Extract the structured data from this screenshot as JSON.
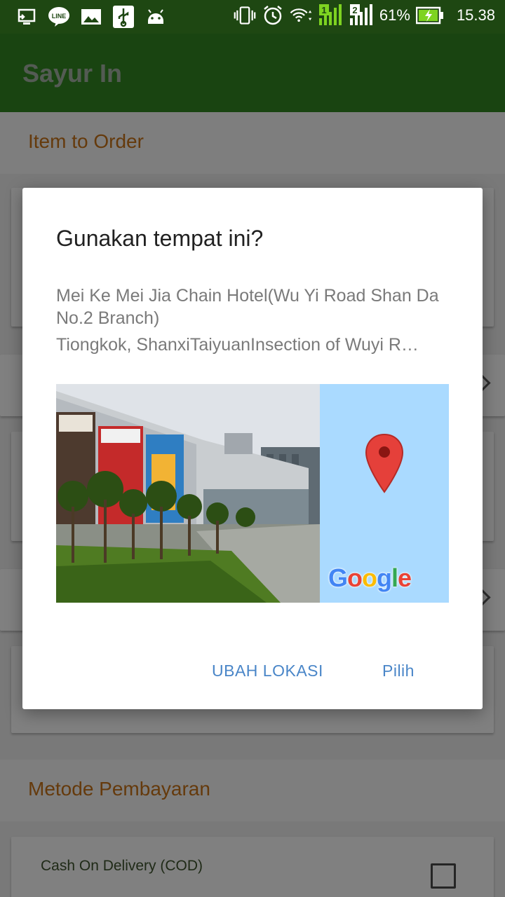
{
  "status_bar": {
    "battery_percent": "61%",
    "time": "15.38",
    "sim1": "1",
    "sim2": "2",
    "line_label": "LINE",
    "icons_left": [
      "screen-cast-icon",
      "line-app-icon",
      "image-icon",
      "usb-icon",
      "android-icon"
    ],
    "icons_right": [
      "vibrate-icon",
      "alarm-icon",
      "wifi-icon",
      "signal-sim1-icon",
      "signal-sim2-icon",
      "battery-charging-icon"
    ]
  },
  "app_bar": {
    "title": "Sayur In"
  },
  "background": {
    "section_items": "Item to Order",
    "section_payment": "Metode Pembayaran",
    "cod_label": "Cash On Delivery (COD)"
  },
  "dialog": {
    "title": "Gunakan tempat ini?",
    "place_name": "Mei Ke Mei Jia Chain Hotel(Wu Yi Road Shan Da No.2 Branch)",
    "address": "Tiongkok, ShanxiTaiyuanInsection of Wuyi R…",
    "map_logo": "Google",
    "button_change": "UBAH LOKASI",
    "button_select": "Pilih"
  },
  "colors": {
    "status_bar": "#1e4712",
    "app_bar": "#2e7d1f",
    "section_label": "#b86a16",
    "dialog_button": "#4a86c8",
    "map_water": "#aadaff",
    "pin": "#e5403a"
  }
}
